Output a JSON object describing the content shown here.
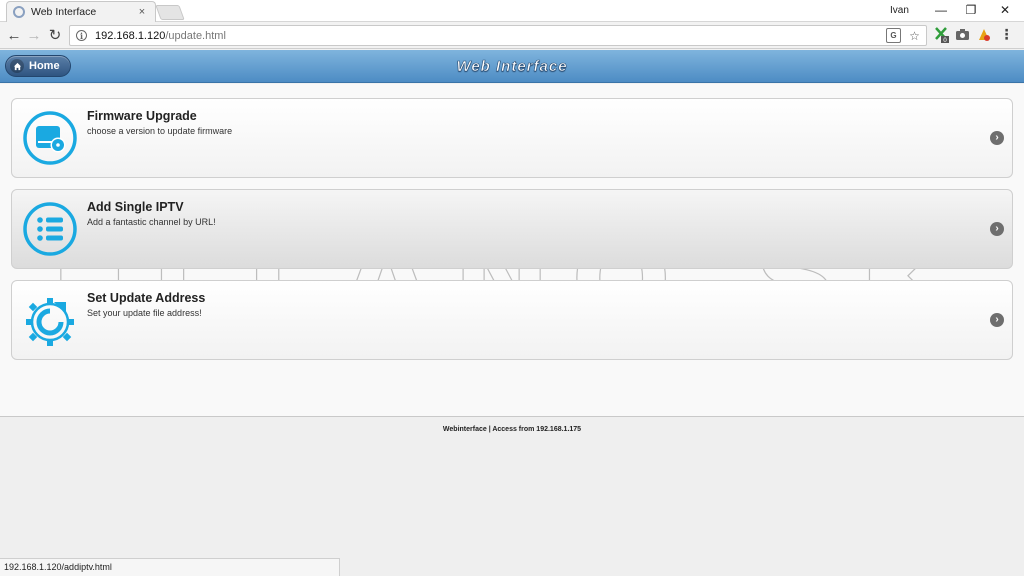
{
  "browser": {
    "tab_title": "Web Interface",
    "tab_close": "×",
    "profile_name": "Ivan",
    "url_host": "192.168.1.120",
    "url_path": "/update.html",
    "status_url": "192.168.1.120/addiptv.html",
    "ext_badge": "0"
  },
  "header": {
    "home_label": "Home",
    "title": "Web Interface"
  },
  "cards": [
    {
      "title": "Firmware Upgrade",
      "description": "choose a version to update firmware"
    },
    {
      "title": "Add Single IPTV",
      "description": "Add a fantastic channel by URL!"
    },
    {
      "title": "Set Update Address",
      "description": "Set your update file address!"
    }
  ],
  "watermark": {
    "text": "ELLANO.SK"
  },
  "footer": {
    "text": "Webinterface | Access from 192.168.1.175"
  },
  "colors": {
    "accent": "#1aa9e1",
    "header_top": "#7fb4dd",
    "header_bottom": "#4d8cc4"
  }
}
